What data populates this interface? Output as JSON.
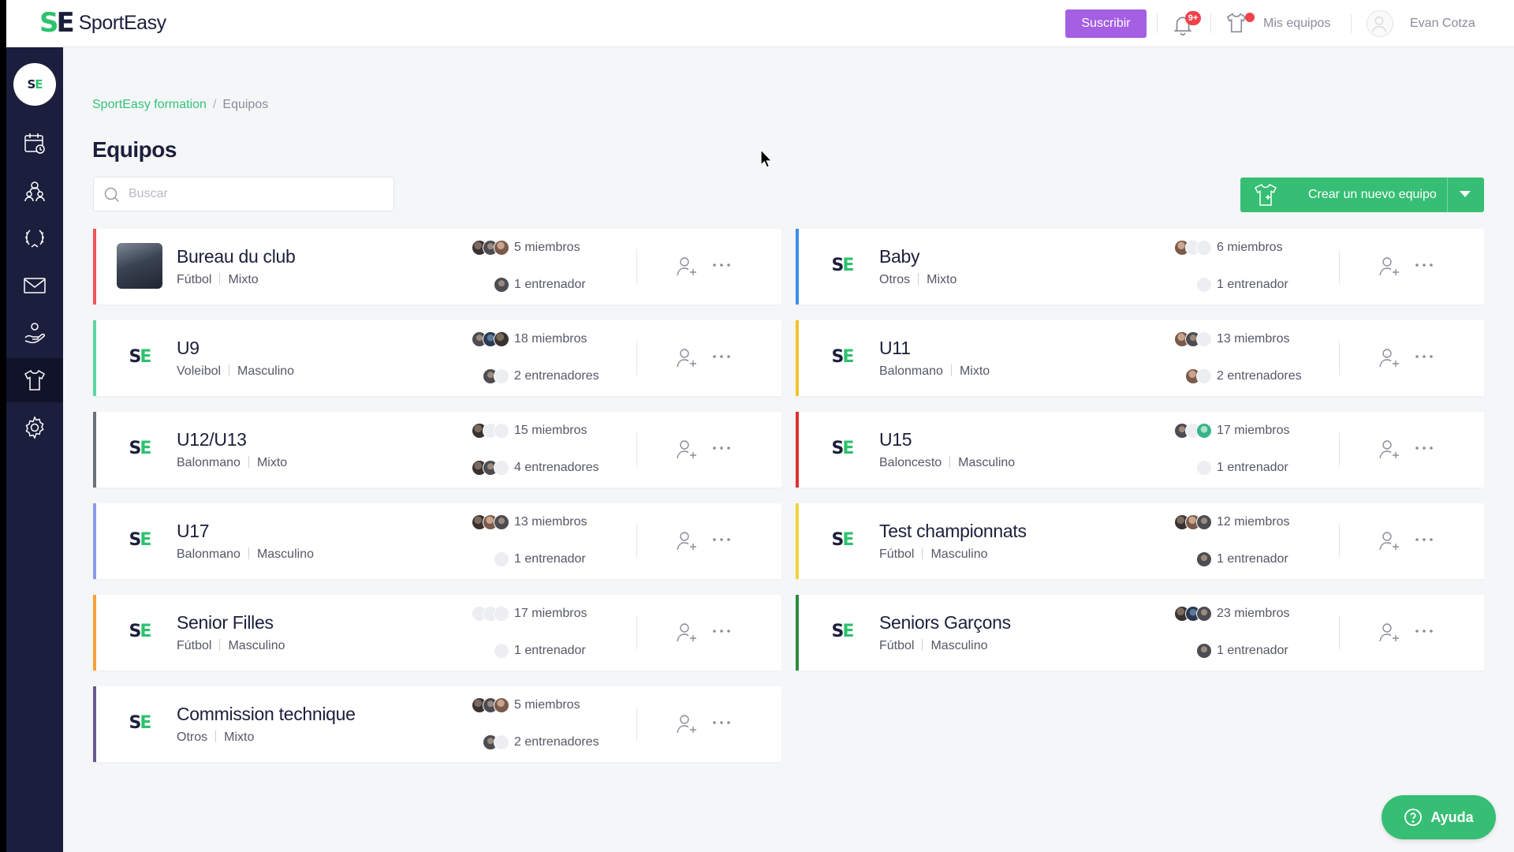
{
  "brand": {
    "name": "SportEasy",
    "accent": "#2cc26e",
    "dark": "#1b1f3b"
  },
  "header": {
    "subscribe_label": "Suscribir",
    "subscribe_color": "#a45fe3",
    "notifications_badge": "9+",
    "my_teams_label": "Mis equipos",
    "user_name": "Evan Cotza"
  },
  "sidebar": {
    "items": [
      {
        "icon": "calendar-icon"
      },
      {
        "icon": "members-icon"
      },
      {
        "icon": "laurel-icon"
      },
      {
        "icon": "mail-icon"
      },
      {
        "icon": "hand-heart-icon"
      },
      {
        "icon": "shirt-icon",
        "active": true
      },
      {
        "icon": "gear-icon"
      }
    ]
  },
  "breadcrumb": {
    "root": "SportEasy formation",
    "current": "Equipos"
  },
  "page": {
    "title": "Equipos",
    "search_placeholder": "Buscar",
    "create_label": "Crear un nuevo equipo"
  },
  "teams": [
    {
      "name": "Bureau du club",
      "sport": "Fútbol",
      "gender": "Mixto",
      "members": "5 miembros",
      "coaches": "1 entrenador",
      "color": "#f0555a"
    },
    {
      "name": "Baby",
      "sport": "Otros",
      "gender": "Mixto",
      "members": "6 miembros",
      "coaches": "1 entrenador",
      "color": "#3a8ee6"
    },
    {
      "name": "U9",
      "sport": "Voleibol",
      "gender": "Masculino",
      "members": "18 miembros",
      "coaches": "2 entrenadores",
      "color": "#5bd6a4"
    },
    {
      "name": "U11",
      "sport": "Balonmano",
      "gender": "Mixto",
      "members": "13 miembros",
      "coaches": "2 entrenadores",
      "color": "#f2c230"
    },
    {
      "name": "U12/U13",
      "sport": "Balonmano",
      "gender": "Mixto",
      "members": "15 miembros",
      "coaches": "4 entrenadores",
      "color": "#6b7079"
    },
    {
      "name": "U15",
      "sport": "Baloncesto",
      "gender": "Masculino",
      "members": "17 miembros",
      "coaches": "1 entrenador",
      "color": "#e0302f"
    },
    {
      "name": "U17",
      "sport": "Balonmano",
      "gender": "Masculino",
      "members": "13 miembros",
      "coaches": "1 entrenador",
      "color": "#8a9be8"
    },
    {
      "name": "Test championnats",
      "sport": "Fútbol",
      "gender": "Masculino",
      "members": "12 miembros",
      "coaches": "1 entrenador",
      "color": "#f2d23a"
    },
    {
      "name": "Senior Filles",
      "sport": "Fútbol",
      "gender": "Masculino",
      "members": "17 miembros",
      "coaches": "1 entrenador",
      "color": "#f7a13a"
    },
    {
      "name": "Seniors Garçons",
      "sport": "Fútbol",
      "gender": "Masculino",
      "members": "23 miembros",
      "coaches": "1 entrenador",
      "color": "#2e8a3e"
    },
    {
      "name": "Commission technique",
      "sport": "Otros",
      "gender": "Mixto",
      "members": "5 miembros",
      "coaches": "2 entrenadores",
      "color": "#6a5a8c"
    }
  ],
  "help": {
    "label": "Ayuda"
  }
}
